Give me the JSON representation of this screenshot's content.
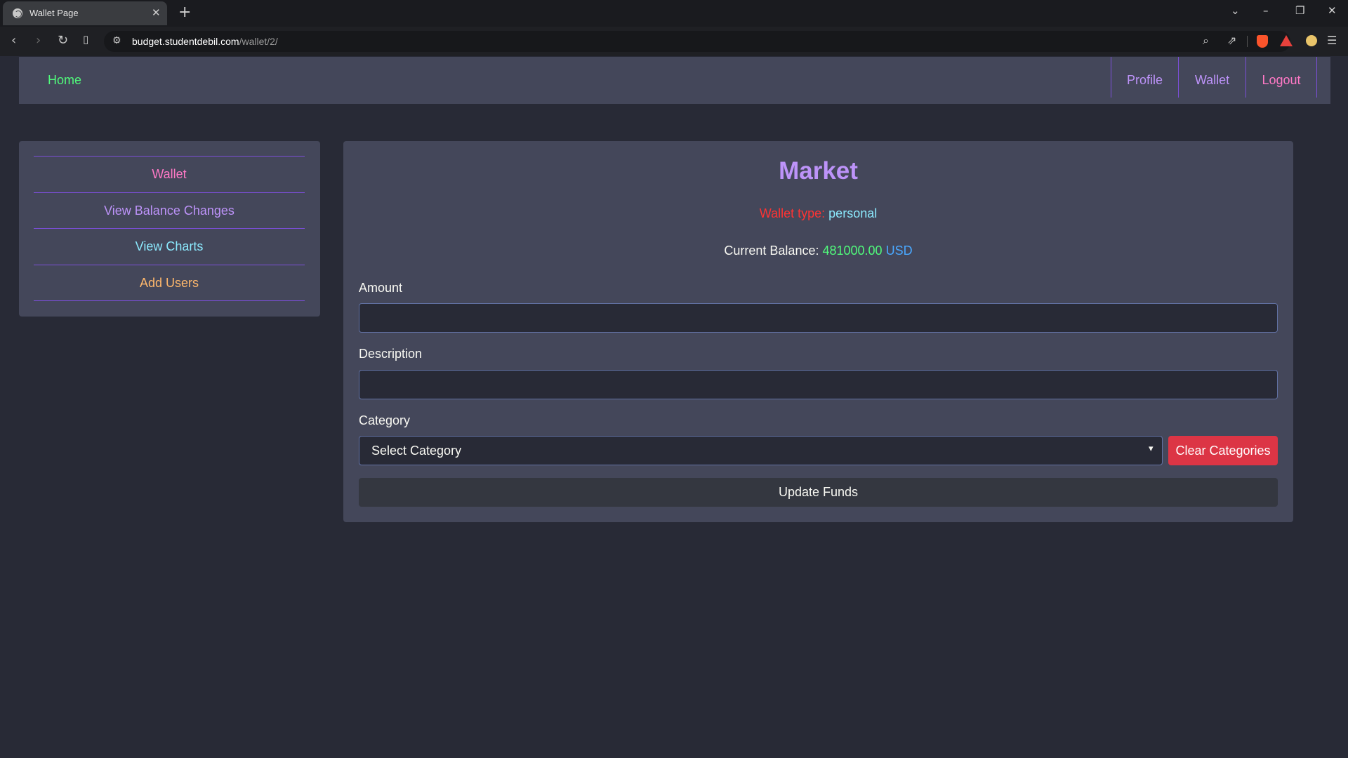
{
  "browser": {
    "tab_title": "Wallet Page",
    "tab_close": "✕",
    "new_tab": "+",
    "url_domain": "budget.studentdebil.com",
    "url_path": "/wallet/2/",
    "window_controls": {
      "dropdown": "⌄",
      "minimize": "–",
      "restore": "❐",
      "close": "✕"
    },
    "icons": [
      "back-icon",
      "forward-icon",
      "reload-icon",
      "bookmark-icon",
      "site-info-icon",
      "zoom-icon",
      "share-icon",
      "brave-shields-icon",
      "brave-rewards-icon",
      "profile-icon",
      "menu-icon"
    ]
  },
  "navbar": {
    "home": "Home",
    "profile": "Profile",
    "wallet": "Wallet",
    "logout": "Logout"
  },
  "sidebar": {
    "items": [
      {
        "label": "Wallet",
        "color": "#ff79c6"
      },
      {
        "label": "View Balance Changes",
        "color": "#bd93f9"
      },
      {
        "label": "View Charts",
        "color": "#8be9fd"
      },
      {
        "label": "Add Users",
        "color": "#ffb86c"
      }
    ]
  },
  "wallet": {
    "title": "Market",
    "type_label": "Wallet type:",
    "type_value": "personal",
    "balance_label": "Current Balance:",
    "balance_amount": "481000.00",
    "balance_currency": "USD"
  },
  "form": {
    "amount_label": "Amount",
    "amount_value": "",
    "description_label": "Description",
    "description_value": "",
    "category_label": "Category",
    "category_selected": "Select Category",
    "clear_button": "Clear Categories",
    "submit_button": "Update Funds"
  },
  "colors": {
    "page_bg": "#282a36",
    "panel_bg": "#44475a",
    "accent_purple": "#bd93f9",
    "accent_green": "#50fa7b",
    "danger": "#dc3545"
  }
}
